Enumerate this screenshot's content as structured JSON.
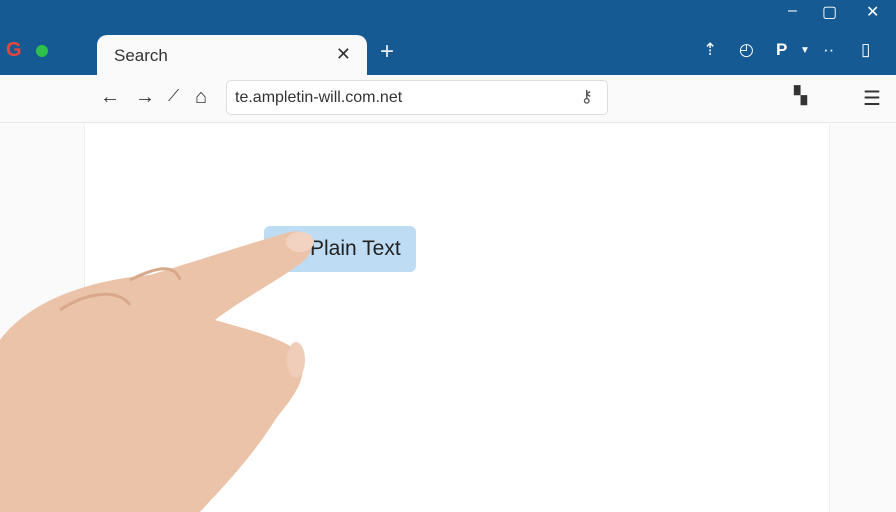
{
  "window": {
    "minimize": "–",
    "maximize": "▢",
    "close": "✕"
  },
  "tab": {
    "title": "Search",
    "close": "✕",
    "new_tab": "+"
  },
  "toolbar_icons": [
    "upload-icon",
    "speed-icon",
    "pin-icon",
    "dropdown-icon",
    "more-icon",
    "clipboard-icon"
  ],
  "address_bar": {
    "url": "te.ampletin-will.com.net"
  },
  "page": {
    "button_label": "Plain Text"
  },
  "colors": {
    "titlebar": "#165a93",
    "button": "#bfdcf5"
  }
}
